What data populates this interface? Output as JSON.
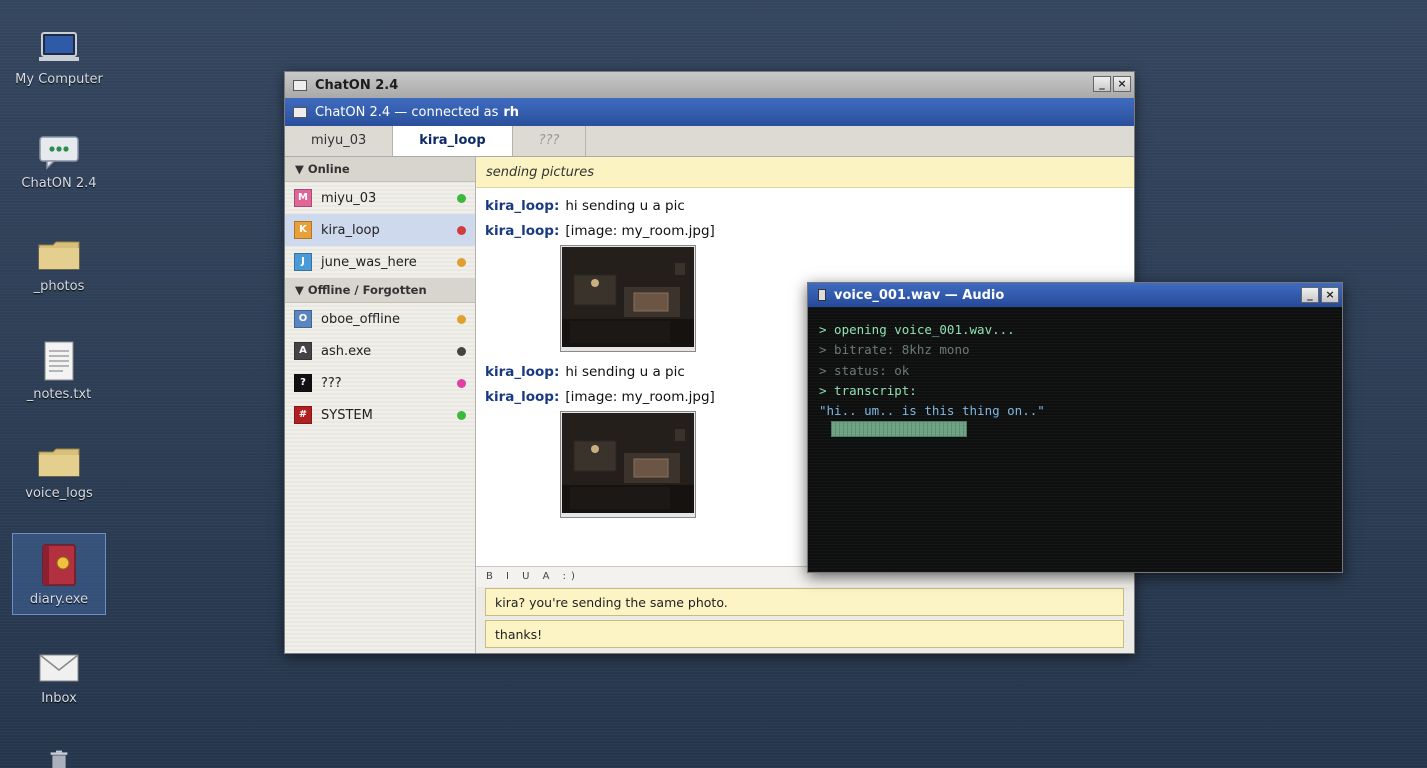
{
  "desktop": {
    "icons": [
      {
        "label": "My Computer",
        "icon": "computer-icon"
      },
      {
        "label": "ChatON 2.4",
        "icon": "chat-icon"
      },
      {
        "label": "_photos",
        "icon": "folder-icon"
      },
      {
        "label": "_notes.txt",
        "icon": "document-icon"
      },
      {
        "label": "voice_logs",
        "icon": "folder-icon"
      },
      {
        "label": "diary.exe",
        "icon": "diary-icon"
      },
      {
        "label": "Inbox",
        "icon": "mail-icon"
      },
      {
        "label": "",
        "icon": "trash-icon"
      }
    ]
  },
  "chat_window": {
    "title": "ChatON 2.4",
    "header_prefix": "ChatON 2.4 — connected as",
    "header_user": "rh",
    "tabs": [
      {
        "label": "miyu_03"
      },
      {
        "label": "kira_loop",
        "active": true
      },
      {
        "label": "???"
      }
    ],
    "groups": {
      "online": "▼ Online",
      "offline": "▼ Offline / Forgotten"
    },
    "contacts_online": [
      {
        "initial": "M",
        "name": "miyu_03",
        "avatar_color": "#e0669a",
        "status_color": "#3cb83c"
      },
      {
        "initial": "K",
        "name": "kira_loop",
        "avatar_color": "#e8a03a",
        "status_color": "#d23c3c"
      },
      {
        "initial": "J",
        "name": "june_was_here",
        "avatar_color": "#4a9ad8",
        "status_color": "#e0a030"
      }
    ],
    "contacts_offline": [
      {
        "initial": "O",
        "name": "oboe_offline",
        "avatar_color": "#5a86c0",
        "status_color": "#e0a030"
      },
      {
        "initial": "A",
        "name": "ash.exe",
        "avatar_color": "#444444",
        "status_color": "#444444"
      },
      {
        "initial": "?",
        "name": "???",
        "avatar_color": "#111111",
        "status_color": "#e040a0"
      },
      {
        "initial": "#",
        "name": "SYSTEM",
        "avatar_color": "#b02020",
        "status_color": "#3cb83c"
      }
    ],
    "topic": "sending pictures",
    "messages": [
      {
        "nick": "kira_loop:",
        "text": "hi sending u a pic"
      },
      {
        "nick": "kira_loop:",
        "text": "[image: my_room.jpg]"
      },
      {
        "nick": "kira_loop:",
        "text": "hi sending u a pic"
      },
      {
        "nick": "kira_loop:",
        "text": "[image: my_room.jpg]"
      }
    ],
    "format_bar": "B I U A :)",
    "inputs": [
      "kira? you're sending the same photo.",
      "thanks!"
    ]
  },
  "audio_window": {
    "title": "voice_001.wav — Audio",
    "lines": [
      {
        "text": "> opening voice_001.wav...",
        "color": "#8fe0b0"
      },
      {
        "text": "> bitrate: 8khz mono",
        "color": "#6a7a74"
      },
      {
        "text": "> status: ok",
        "color": "#6a7a74"
      },
      {
        "text": "> transcript:",
        "color": "#8fe0b0"
      },
      {
        "text": "\"hi.. um.. is this thing on..\"",
        "color": "#7fb6e0"
      }
    ],
    "progress_fraction": 1.0
  },
  "window_buttons": {
    "minimize": "_",
    "close": "×"
  }
}
